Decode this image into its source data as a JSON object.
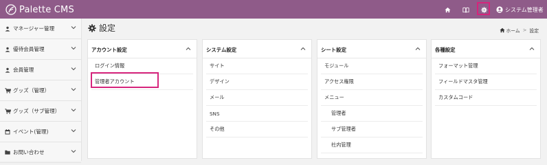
{
  "app": {
    "logo_text": "Palette CMS"
  },
  "header": {
    "icons": [
      "home-icon",
      "book-icon",
      "gear-icon",
      "user-circle-icon"
    ],
    "user_label": "システム管理者",
    "colors": {
      "bar": "#8f5b89",
      "highlight": "#d6247c"
    }
  },
  "sidebar": {
    "items": [
      {
        "label": "マネージャー管理",
        "icon": "user-icon"
      },
      {
        "label": "優待会員管理",
        "icon": "user-icon"
      },
      {
        "label": "会員管理",
        "icon": "user-icon"
      },
      {
        "label": "グッズ（管理）",
        "icon": "cart-icon"
      },
      {
        "label": "グッズ（サブ管理）",
        "icon": "cart-icon"
      },
      {
        "label": "イベント(管理)",
        "icon": "calendar-icon"
      },
      {
        "label": "お問い合わせ",
        "icon": "folder-icon"
      }
    ]
  },
  "page": {
    "title": "設定"
  },
  "breadcrumb": {
    "home": "ホーム",
    "separator": ">",
    "current": "設定"
  },
  "panels": [
    {
      "title": "アカウント設定",
      "items": [
        {
          "label": "ログイン情報",
          "sub": false
        },
        {
          "label": "管理者アカウント",
          "sub": false
        }
      ]
    },
    {
      "title": "システム設定",
      "items": [
        {
          "label": "サイト",
          "sub": false
        },
        {
          "label": "デザイン",
          "sub": false
        },
        {
          "label": "メール",
          "sub": false
        },
        {
          "label": "SNS",
          "sub": false
        },
        {
          "label": "その他",
          "sub": false
        }
      ]
    },
    {
      "title": "シート設定",
      "items": [
        {
          "label": "モジュール",
          "sub": false
        },
        {
          "label": "アクセス権限",
          "sub": false
        },
        {
          "label": "メニュー",
          "sub": false
        },
        {
          "label": "管理者",
          "sub": true
        },
        {
          "label": "サブ管理者",
          "sub": true
        },
        {
          "label": "社内管理",
          "sub": true
        }
      ]
    },
    {
      "title": "各種設定",
      "items": [
        {
          "label": "フォーマット管理",
          "sub": false
        },
        {
          "label": "フィールドマスタ管理",
          "sub": false
        },
        {
          "label": "カスタムコード",
          "sub": false
        }
      ]
    }
  ]
}
